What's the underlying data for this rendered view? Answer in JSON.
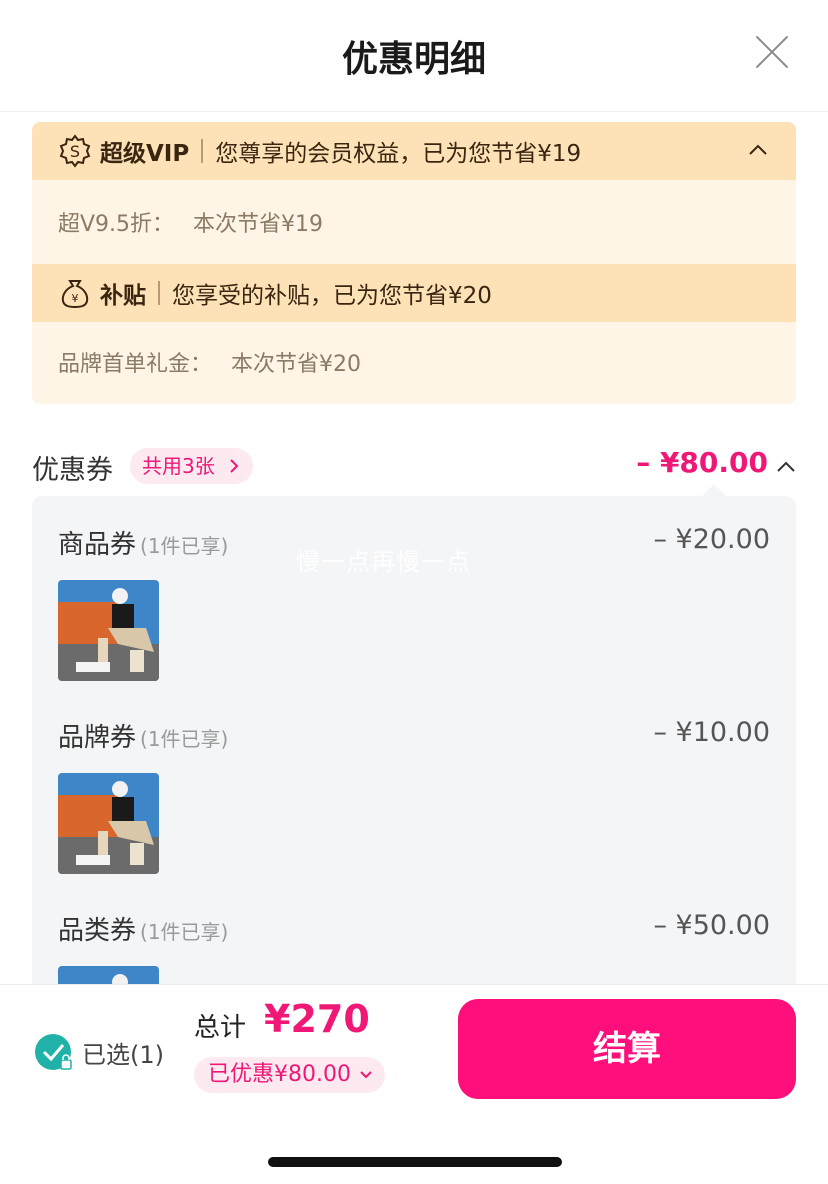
{
  "header": {
    "title": "优惠明细"
  },
  "benefits": {
    "vip": {
      "icon": "dollar-badge-icon",
      "name": "超级VIP",
      "summary": "您尊享的会员权益，已为您节省¥19",
      "detail_label": "超V9.5折：",
      "detail_value": "本次节省¥19"
    },
    "subsidy": {
      "icon": "money-bag-icon",
      "name": "补贴",
      "summary": "您享受的补贴，已为您节省¥20",
      "detail_label": "品牌首单礼金：",
      "detail_value": "本次节省¥20"
    }
  },
  "coupons": {
    "label": "优惠券",
    "pill": "共用3张",
    "total": "– ¥80.00",
    "items": [
      {
        "name": "商品券",
        "note": "(1件已享)",
        "amount": "– ¥20.00"
      },
      {
        "name": "品牌券",
        "note": "(1件已享)",
        "amount": "– ¥10.00"
      },
      {
        "name": "品类券",
        "note": "(1件已享)",
        "amount": "– ¥50.00"
      }
    ]
  },
  "watermark": "慢一点再慢一点",
  "footer": {
    "selected": "已选(1)",
    "total_label": "总计",
    "total_value": "¥270",
    "discount": "已优惠¥80.00",
    "checkout": "结算"
  },
  "colors": {
    "accent": "#ff0f7b",
    "accent_text": "#f01877",
    "benefit_bg": "#fff5e6",
    "benefit_head": "#fde2b8",
    "check": "#20b2a8"
  }
}
